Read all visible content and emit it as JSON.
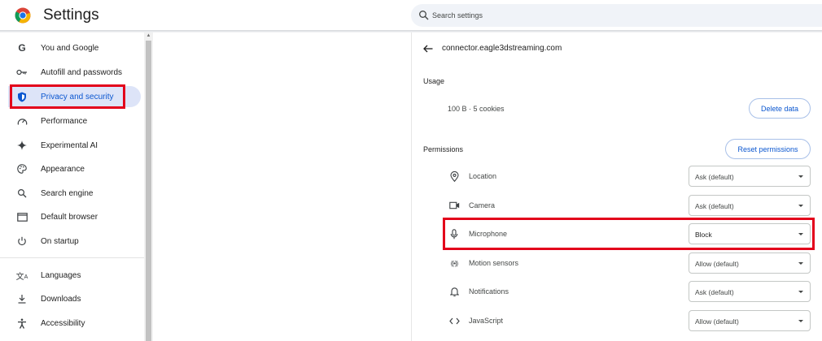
{
  "header": {
    "title": "Settings",
    "search_placeholder": "Search settings"
  },
  "sidebar": {
    "items": [
      {
        "label": "You and Google",
        "icon": "google-g-icon",
        "active": false
      },
      {
        "label": "Autofill and passwords",
        "icon": "key-icon",
        "active": false
      },
      {
        "label": "Privacy and security",
        "icon": "shield-icon",
        "active": true
      },
      {
        "label": "Performance",
        "icon": "speedometer-icon",
        "active": false
      },
      {
        "label": "Experimental AI",
        "icon": "sparkle-icon",
        "active": false
      },
      {
        "label": "Appearance",
        "icon": "palette-icon",
        "active": false
      },
      {
        "label": "Search engine",
        "icon": "search-icon",
        "active": false
      },
      {
        "label": "Default browser",
        "icon": "browser-window-icon",
        "active": false
      },
      {
        "label": "On startup",
        "icon": "power-icon",
        "active": false
      },
      {
        "label": "Languages",
        "icon": "translate-icon",
        "active": false
      },
      {
        "label": "Downloads",
        "icon": "download-icon",
        "active": false
      },
      {
        "label": "Accessibility",
        "icon": "accessibility-icon",
        "active": false
      }
    ]
  },
  "panel": {
    "site": "connector.eagle3dstreaming.com",
    "usage_heading": "Usage",
    "usage_value": "100 B · 5 cookies",
    "delete_button": "Delete data",
    "permissions_heading": "Permissions",
    "reset_button": "Reset permissions",
    "permissions": [
      {
        "label": "Location",
        "value": "Ask (default)",
        "icon": "location-pin-icon"
      },
      {
        "label": "Camera",
        "value": "Ask (default)",
        "icon": "camera-icon"
      },
      {
        "label": "Microphone",
        "value": "Block",
        "icon": "microphone-icon"
      },
      {
        "label": "Motion sensors",
        "value": "Allow (default)",
        "icon": "motion-sensor-icon"
      },
      {
        "label": "Notifications",
        "value": "Ask (default)",
        "icon": "bell-icon"
      },
      {
        "label": "JavaScript",
        "value": "Allow (default)",
        "icon": "code-icon"
      }
    ]
  },
  "colors": {
    "accent": "#0b57d0",
    "highlight": "#e3001b",
    "active_bg": "#dde4f8"
  }
}
